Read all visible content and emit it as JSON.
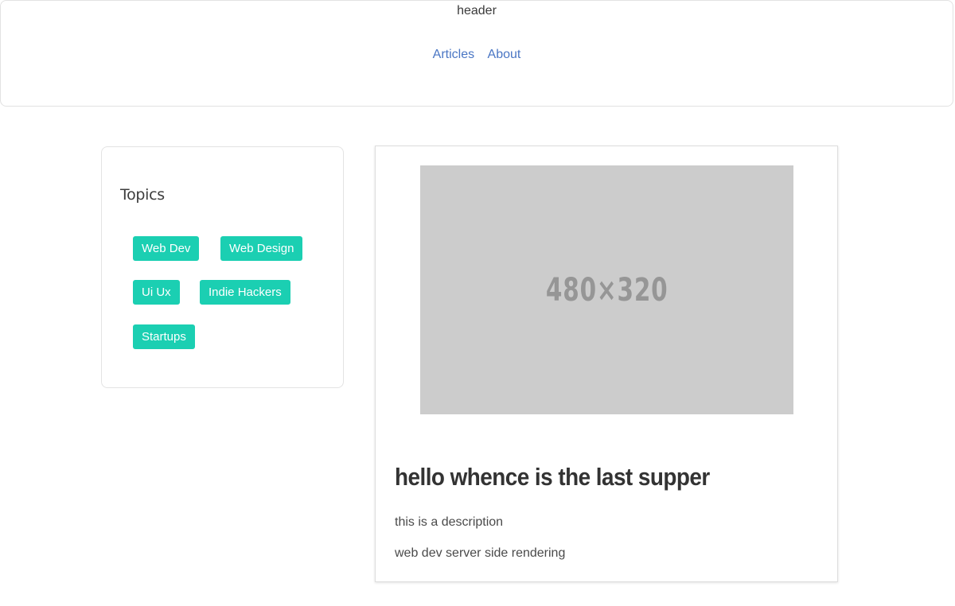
{
  "header": {
    "label": "header",
    "nav": [
      {
        "label": "Articles"
      },
      {
        "label": "About"
      }
    ]
  },
  "sidebar": {
    "title": "Topics",
    "tags": [
      {
        "label": "Web Dev"
      },
      {
        "label": "Web Design"
      },
      {
        "label": "Ui Ux"
      },
      {
        "label": "Indie Hackers"
      },
      {
        "label": "Startups"
      }
    ]
  },
  "article": {
    "image_placeholder": "480×320",
    "title": "hello whence is the last supper",
    "description": "this is a description",
    "tags_line": "web dev server side rendering"
  },
  "colors": {
    "tag_bg": "#1bcfb2",
    "link": "#4a76c4"
  }
}
